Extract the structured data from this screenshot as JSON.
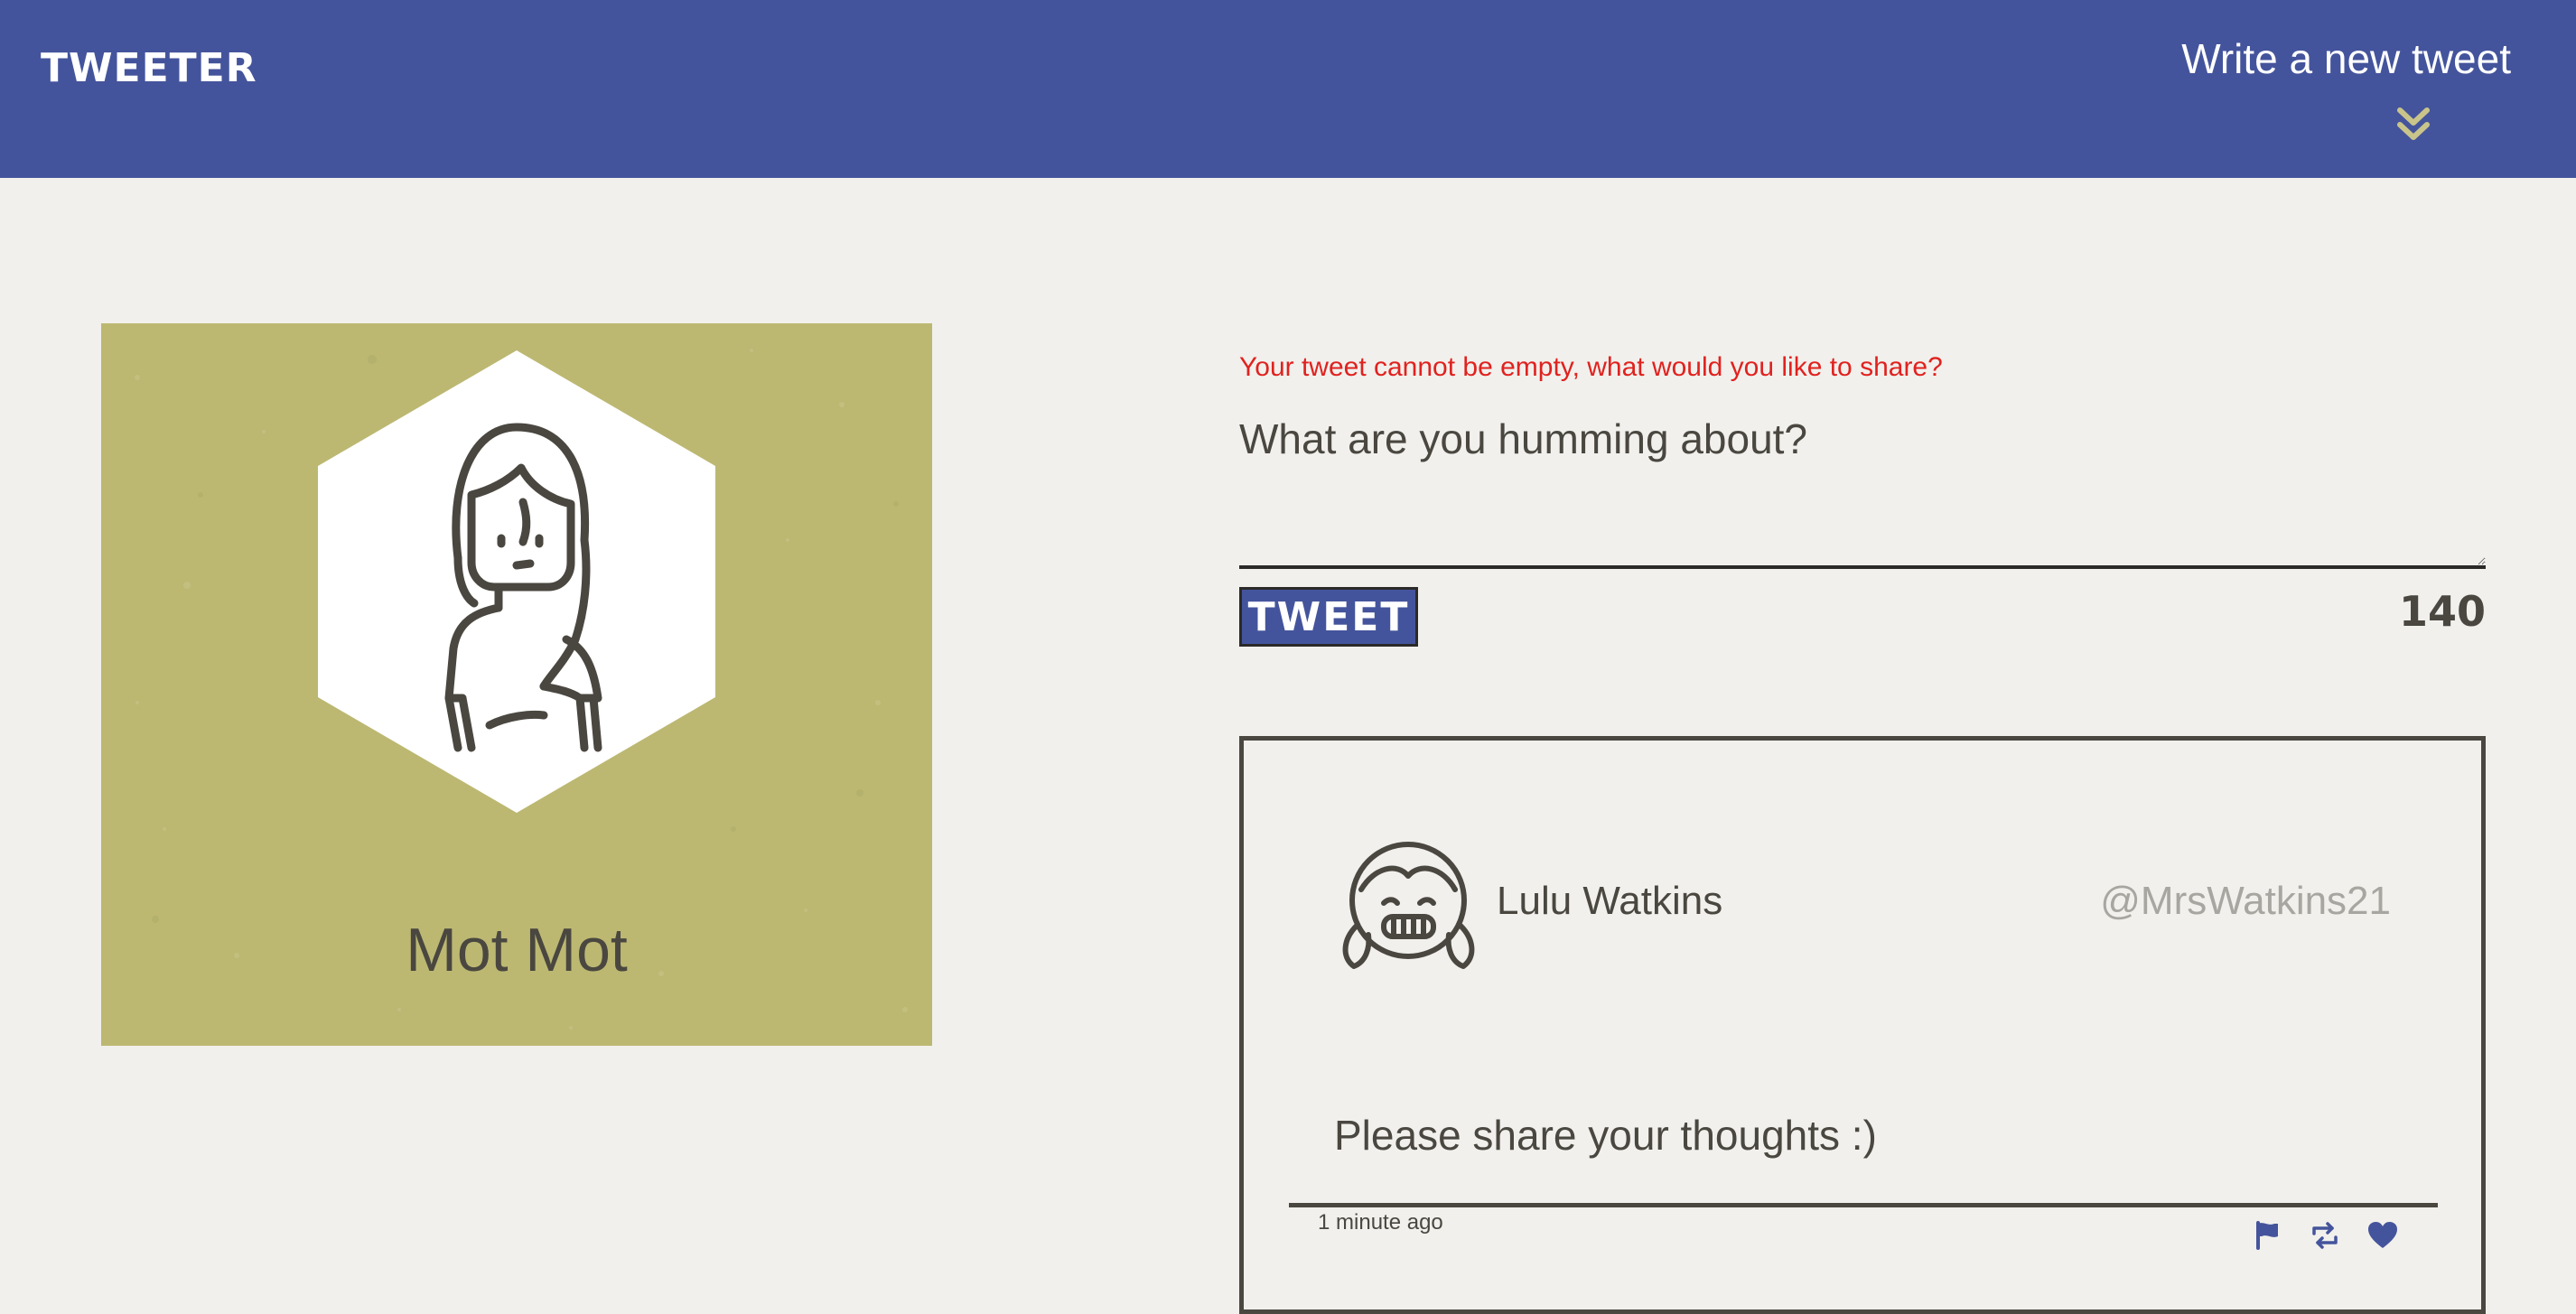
{
  "nav": {
    "brand": "TWEETER",
    "compose_label": "Write a new tweet",
    "compose_icon": "double-chevron-down-icon"
  },
  "profile": {
    "name": "Mot Mot",
    "avatar_icon": "woman-avatar-icon",
    "card_color": "#bcb872"
  },
  "composer": {
    "error": "Your tweet cannot be empty, what would you like to share?",
    "placeholder": "What are you humming about?",
    "value": "",
    "button_label": "TWEET",
    "counter": "140"
  },
  "tweet": {
    "name": "Lulu Watkins",
    "handle": "@MrsWatkins21",
    "body": "Please share your thoughts :)",
    "timestamp": "1 minute ago",
    "avatar_icon": "girl-avatar-icon",
    "actions": [
      "flag-icon",
      "retweet-icon",
      "heart-icon"
    ]
  },
  "colors": {
    "nav": "#44549c",
    "background": "#f1f0ec",
    "text": "#4a4740",
    "error": "#e0221f",
    "accent_chevron": "#c9c48a",
    "handle": "#a8a6a0"
  }
}
